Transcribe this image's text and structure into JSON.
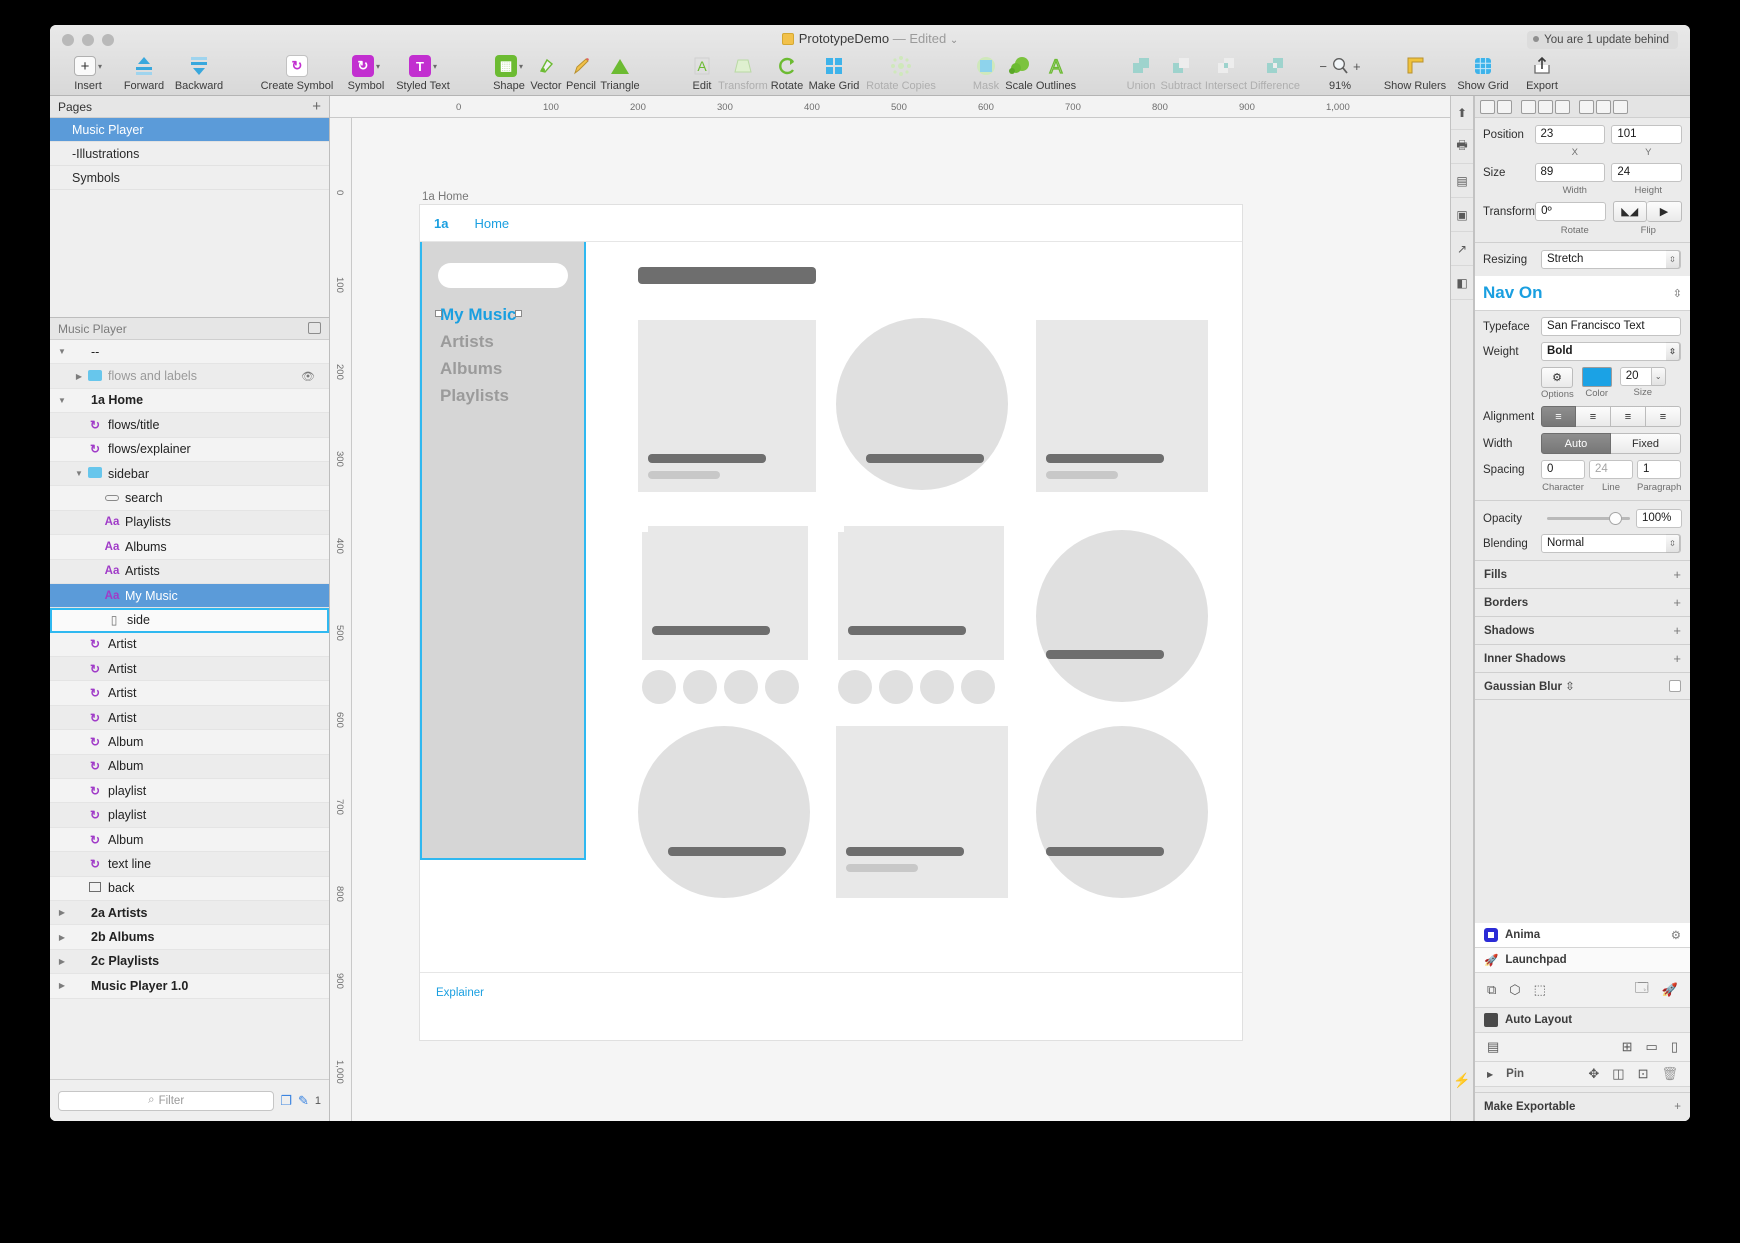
{
  "window": {
    "doc_title": "PrototypeDemo",
    "edited": "— Edited",
    "chevron": "⌄",
    "update_notice": "You are 1 update behind"
  },
  "toolbar": {
    "items": [
      {
        "label": "Insert",
        "icon": "plus-icon",
        "dropdown": true
      },
      {
        "label": "Forward",
        "icon": "forward-icon",
        "dropdown": false
      },
      {
        "label": "Backward",
        "icon": "backward-icon",
        "dropdown": false
      },
      {
        "label": "Create Symbol",
        "icon": "create-symbol-icon",
        "dropdown": false
      },
      {
        "label": "Symbol",
        "icon": "symbol-icon",
        "dropdown": true
      },
      {
        "label": "Styled Text",
        "icon": "styled-text-icon",
        "dropdown": true
      },
      {
        "label": "Shape",
        "icon": "shape-icon",
        "dropdown": true
      },
      {
        "label": "Vector",
        "icon": "vector-pen-icon",
        "dropdown": false
      },
      {
        "label": "Pencil",
        "icon": "pencil-icon",
        "dropdown": false
      },
      {
        "label": "Triangle",
        "icon": "triangle-icon",
        "dropdown": false
      },
      {
        "label": "Edit",
        "icon": "edit-icon",
        "dropdown": false
      },
      {
        "label": "Transform",
        "icon": "transform-icon",
        "dropdown": false
      },
      {
        "label": "Rotate",
        "icon": "rotate-icon",
        "dropdown": false
      },
      {
        "label": "Make Grid",
        "icon": "make-grid-icon",
        "dropdown": false
      },
      {
        "label": "Rotate Copies",
        "icon": "rotate-copies-icon",
        "dropdown": false
      },
      {
        "label": "Mask",
        "icon": "mask-icon",
        "dropdown": false
      },
      {
        "label": "Scale",
        "icon": "scale-icon",
        "dropdown": false
      },
      {
        "label": "Outlines",
        "icon": "outlines-icon",
        "dropdown": false
      },
      {
        "label": "Union",
        "icon": "union-icon",
        "dropdown": false
      },
      {
        "label": "Subtract",
        "icon": "subtract-icon",
        "dropdown": false
      },
      {
        "label": "Intersect",
        "icon": "intersect-icon",
        "dropdown": false
      },
      {
        "label": "Difference",
        "icon": "difference-icon",
        "dropdown": false
      },
      {
        "label": "Show Rulers",
        "icon": "ruler-icon",
        "dropdown": false
      },
      {
        "label": "Show Grid",
        "icon": "grid-icon",
        "dropdown": false
      },
      {
        "label": "Export",
        "icon": "export-icon",
        "dropdown": false
      }
    ],
    "zoom_minus": "−",
    "zoom_plus": "+",
    "zoom_level": "91%"
  },
  "pages": {
    "header": "Pages",
    "add_label": "+",
    "items": [
      {
        "label": "Music Player",
        "selected": true
      },
      {
        "label": "-Illustrations",
        "selected": false
      },
      {
        "label": "Symbols",
        "selected": false
      }
    ]
  },
  "layers": {
    "header": "Music Player",
    "rows": [
      {
        "label": "--",
        "icon": "none",
        "indent": 0,
        "tri": "down",
        "state": "normal"
      },
      {
        "label": "flows and labels",
        "icon": "folder",
        "indent": 1,
        "tri": "right",
        "state": "dim",
        "eye": true
      },
      {
        "label": "1a Home",
        "icon": "none",
        "indent": 0,
        "tri": "down",
        "state": "bold"
      },
      {
        "label": "flows/title",
        "icon": "symbol",
        "indent": 1,
        "tri": "",
        "state": "normal"
      },
      {
        "label": "flows/explainer",
        "icon": "symbol",
        "indent": 1,
        "tri": "",
        "state": "normal"
      },
      {
        "label": "sidebar",
        "icon": "folder",
        "indent": 1,
        "tri": "down",
        "state": "normal"
      },
      {
        "label": "search",
        "icon": "pill",
        "indent": 2,
        "tri": "",
        "state": "normal"
      },
      {
        "label": "Playlists",
        "icon": "text",
        "indent": 2,
        "tri": "",
        "state": "normal"
      },
      {
        "label": "Albums",
        "icon": "text",
        "indent": 2,
        "tri": "",
        "state": "normal"
      },
      {
        "label": "Artists",
        "icon": "text",
        "indent": 2,
        "tri": "",
        "state": "normal"
      },
      {
        "label": "My Music",
        "icon": "text",
        "indent": 2,
        "tri": "",
        "state": "selected"
      },
      {
        "label": "side",
        "icon": "bar",
        "indent": 2,
        "tri": "",
        "state": "editing"
      },
      {
        "label": "Artist",
        "icon": "symbol",
        "indent": 1,
        "tri": "",
        "state": "normal"
      },
      {
        "label": "Artist",
        "icon": "symbol",
        "indent": 1,
        "tri": "",
        "state": "normal"
      },
      {
        "label": "Artist",
        "icon": "symbol",
        "indent": 1,
        "tri": "",
        "state": "normal"
      },
      {
        "label": "Artist",
        "icon": "symbol",
        "indent": 1,
        "tri": "",
        "state": "normal"
      },
      {
        "label": "Album",
        "icon": "symbol",
        "indent": 1,
        "tri": "",
        "state": "normal"
      },
      {
        "label": "Album",
        "icon": "symbol",
        "indent": 1,
        "tri": "",
        "state": "normal"
      },
      {
        "label": "playlist",
        "icon": "symbol",
        "indent": 1,
        "tri": "",
        "state": "normal"
      },
      {
        "label": "playlist",
        "icon": "symbol",
        "indent": 1,
        "tri": "",
        "state": "normal"
      },
      {
        "label": "Album",
        "icon": "symbol",
        "indent": 1,
        "tri": "",
        "state": "normal"
      },
      {
        "label": "text line",
        "icon": "symbol",
        "indent": 1,
        "tri": "",
        "state": "normal"
      },
      {
        "label": "back",
        "icon": "rect",
        "indent": 1,
        "tri": "",
        "state": "normal"
      },
      {
        "label": "2a Artists",
        "icon": "none",
        "indent": 0,
        "tri": "right",
        "state": "bold"
      },
      {
        "label": "2b Albums",
        "icon": "none",
        "indent": 0,
        "tri": "right",
        "state": "bold"
      },
      {
        "label": "2c Playlists",
        "icon": "none",
        "indent": 0,
        "tri": "right",
        "state": "bold"
      },
      {
        "label": "Music Player 1.0",
        "icon": "none",
        "indent": 0,
        "tri": "right",
        "state": "bold"
      }
    ],
    "filter_placeholder": "Filter",
    "filter_value": "",
    "filter_count": "1"
  },
  "rulers": {
    "top_ticks": [
      "0",
      "100",
      "200",
      "300",
      "400",
      "500",
      "600",
      "700",
      "800",
      "900",
      "1,000"
    ],
    "left_ticks": [
      "0",
      "100",
      "200",
      "300",
      "400",
      "500",
      "600",
      "700",
      "800",
      "900",
      "1,000"
    ]
  },
  "artboard": {
    "name": "1a Home",
    "nav_number": "1a",
    "nav_title": "Home",
    "menu": [
      {
        "label": "My Music",
        "active": true
      },
      {
        "label": "Artists",
        "active": false
      },
      {
        "label": "Albums",
        "active": false
      },
      {
        "label": "Playlists",
        "active": false
      }
    ],
    "footer_link": "Explainer"
  },
  "inspector": {
    "position_label": "Position",
    "position_x": "23",
    "position_y": "101",
    "x_caption": "X",
    "y_caption": "Y",
    "size_label": "Size",
    "width_value": "89",
    "height_value": "24",
    "width_caption": "Width",
    "height_caption": "Height",
    "transform_label": "Transform",
    "rotate_value": "0º",
    "rotate_caption": "Rotate",
    "flip_caption": "Flip",
    "resizing_label": "Resizing",
    "resizing_value": "Stretch",
    "style_name": "Nav On",
    "typeface_label": "Typeface",
    "typeface_value": "San Francisco Text",
    "weight_label": "Weight",
    "weight_value": "Bold",
    "options_caption": "Options",
    "color_caption": "Color",
    "color_hex": "#1ba2e5",
    "size_value": "20",
    "size_caption": "Size",
    "alignment_label": "Alignment",
    "width_label": "Width",
    "width_auto": "Auto",
    "width_fixed": "Fixed",
    "spacing_label": "Spacing",
    "spacing_character": "0",
    "spacing_line": "24",
    "spacing_paragraph": "1",
    "character_caption": "Character",
    "line_caption": "Line",
    "paragraph_caption": "Paragraph",
    "opacity_label": "Opacity",
    "opacity_value": "100%",
    "blending_label": "Blending",
    "blending_value": "Normal",
    "sections": [
      {
        "label": "Fills",
        "action": "+"
      },
      {
        "label": "Borders",
        "action": "+"
      },
      {
        "label": "Shadows",
        "action": "+"
      },
      {
        "label": "Inner Shadows",
        "action": "+"
      }
    ],
    "gaussian_blur_label": "Gaussian Blur",
    "plugins": {
      "anima": "Anima",
      "launchpad": "Launchpad",
      "auto_layout": "Auto Layout",
      "pin": "Pin"
    },
    "make_exportable": "Make Exportable",
    "make_exportable_action": "+"
  }
}
